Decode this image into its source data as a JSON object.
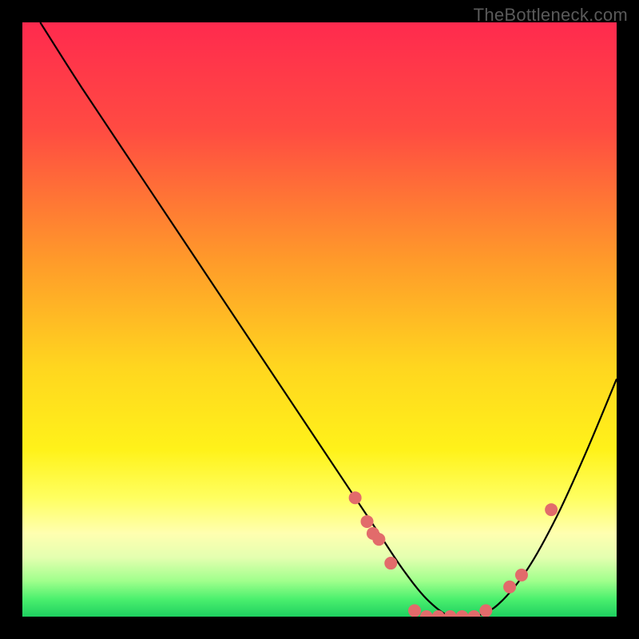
{
  "watermark": "TheBottleneck.com",
  "chart_data": {
    "type": "line",
    "title": "",
    "xlabel": "",
    "ylabel": "",
    "xlim": [
      0,
      100
    ],
    "ylim": [
      0,
      100
    ],
    "grid": false,
    "legend": false,
    "series": [
      {
        "name": "bottleneck-curve",
        "x": [
          3,
          10,
          20,
          30,
          40,
          50,
          56,
          60,
          64,
          68,
          72,
          76,
          80,
          85,
          90,
          95,
          100
        ],
        "y": [
          100,
          89,
          74,
          59,
          44,
          29,
          20,
          14,
          8,
          3,
          0,
          0,
          2,
          8,
          17,
          28,
          40
        ]
      }
    ],
    "markers": [
      {
        "x": 56,
        "y": 20
      },
      {
        "x": 58,
        "y": 16
      },
      {
        "x": 59,
        "y": 14
      },
      {
        "x": 60,
        "y": 13
      },
      {
        "x": 62,
        "y": 9
      },
      {
        "x": 66,
        "y": 1
      },
      {
        "x": 68,
        "y": 0
      },
      {
        "x": 70,
        "y": 0
      },
      {
        "x": 72,
        "y": 0
      },
      {
        "x": 74,
        "y": 0
      },
      {
        "x": 76,
        "y": 0
      },
      {
        "x": 78,
        "y": 1
      },
      {
        "x": 82,
        "y": 5
      },
      {
        "x": 84,
        "y": 7
      },
      {
        "x": 89,
        "y": 18
      }
    ],
    "background": {
      "type": "vertical-gradient",
      "description": "red-orange-yellow top fading into green band at bottom",
      "stops": [
        {
          "pos": 0.0,
          "color": "#ff2a4e"
        },
        {
          "pos": 0.18,
          "color": "#ff4b42"
        },
        {
          "pos": 0.4,
          "color": "#ff9a2a"
        },
        {
          "pos": 0.58,
          "color": "#ffd61f"
        },
        {
          "pos": 0.72,
          "color": "#fff21a"
        },
        {
          "pos": 0.8,
          "color": "#ffff60"
        },
        {
          "pos": 0.86,
          "color": "#ffffb0"
        },
        {
          "pos": 0.9,
          "color": "#e4ffb0"
        },
        {
          "pos": 0.94,
          "color": "#a0ff8c"
        },
        {
          "pos": 0.97,
          "color": "#4cf06e"
        },
        {
          "pos": 1.0,
          "color": "#1ed060"
        }
      ]
    },
    "marker_style": {
      "color": "#e26b6b",
      "radius": 8
    },
    "line_style": {
      "color": "#000000",
      "width": 2.2
    }
  }
}
